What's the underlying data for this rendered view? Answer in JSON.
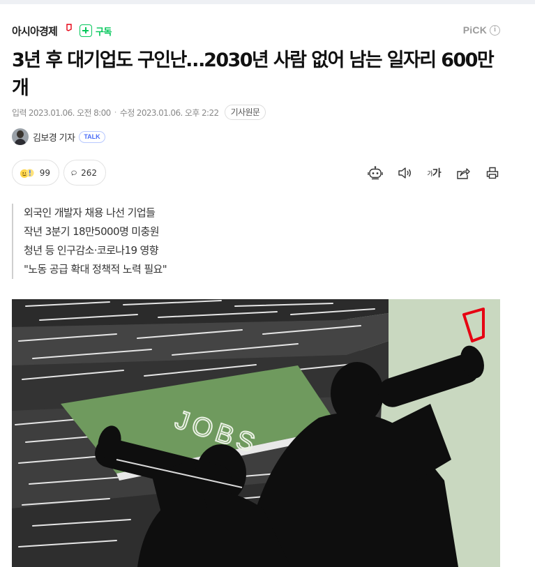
{
  "article": {
    "press": {
      "name": "아시아경제",
      "subscribe_label": "구독",
      "pick_label": "PiCK",
      "info_icon": "i",
      "logo_color": "#e60012"
    },
    "title": "3년 후 대기업도 구인난…2030년 사람 없어 남는 일자리 600만개",
    "dates": {
      "input_label": "입력",
      "input_value": "2023.01.06. 오전 8:00",
      "modified_label": "수정",
      "modified_value": "2023.01.06. 오후 2:22",
      "original_button": "기사원문"
    },
    "reporter": {
      "name": "김보경 기자",
      "talk_label": "TALK"
    },
    "reactions": {
      "like_count": "99",
      "comment_count": "262"
    },
    "tools": {
      "font_small": "가",
      "font_big": "가"
    },
    "summary": [
      "외국인 개발자 채용 나선 기업들",
      "작년 3분기 18만5000명 미충원",
      "청년 등 인구감소·코로나19 영향",
      "\"노동 공급 확대 정책적 노력 필요\""
    ],
    "photo": {
      "sign_text": "JOBS",
      "sign_color": "#6f9a5e",
      "accent_color": "#e60012"
    }
  },
  "colors": {
    "subscribe_green": "#03c75a",
    "talk_blue": "#4a6cf7",
    "muted_text": "#8a8a8a"
  }
}
